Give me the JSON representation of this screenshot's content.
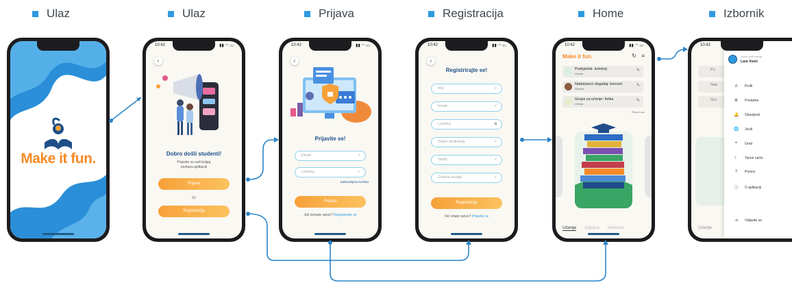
{
  "labels": [
    "Ulaz",
    "Ulaz",
    "Prijava",
    "Registracija",
    "Home",
    "Izbornik"
  ],
  "status": {
    "time": "10:42",
    "icons": "▮▮ ◠ ▭"
  },
  "splash": {
    "logo_text": "Make it fun."
  },
  "welcome": {
    "title": "Dobro došli studenti!",
    "subtitle": "Prijavite se radi boljeg pristupa aplikaciji",
    "login_button": "Prijava",
    "or_text": "ILI",
    "register_button": "Registracija"
  },
  "login": {
    "title": "Prijavite se!",
    "email_placeholder": "Email",
    "password_placeholder": "Lozinka",
    "forgot": "Zaboravljena lozinka",
    "login_button": "Prijava",
    "no_account": "Još nemate račun?",
    "register_link": "Registrirajte se"
  },
  "register": {
    "title": "Registrirajte se!",
    "fields": [
      "Ime",
      "Email",
      "Lozinka",
      "Smjer studiranja",
      "Studij",
      "Godina studija"
    ],
    "register_button": "Registracija",
    "have_account": "Već imate račun?",
    "login_link": "Prijavite se"
  },
  "home": {
    "brand": "Make it fun.",
    "items": [
      {
        "title": "Podsjetnik- kolokvij",
        "tag": "Učenje"
      },
      {
        "title": "Nadolazeći događaj: koncert",
        "tag": "Zabava"
      },
      {
        "title": "Grupa za učenje- fizika",
        "tag": "Učenje"
      }
    ],
    "see_all": "Prikaži sve",
    "tabs": [
      "Učenje",
      "Zabava",
      "Network"
    ]
  },
  "menu": {
    "greeting": "Dobro došli natrag",
    "user_name": "Lara Vusić",
    "items": [
      {
        "icon": "♙",
        "label": "Profil"
      },
      {
        "icon": "⚙",
        "label": "Postavke"
      },
      {
        "icon": "🔔",
        "label": "Obavijesti"
      },
      {
        "icon": "🌐",
        "label": "Jezik"
      },
      {
        "icon": "⌖",
        "label": "Grad"
      },
      {
        "icon": "☾",
        "label": "Tamni način"
      },
      {
        "icon": "?",
        "label": "Pomoć"
      },
      {
        "icon": "ⓘ",
        "label": "O aplikaciji"
      }
    ],
    "logout": "Odjavite se",
    "behind_items": [
      "Po",
      "Nad",
      "Gru"
    ],
    "behind_tab": "Učenje"
  },
  "colors": {
    "accent": "#2f9ae0",
    "navy": "#1d4f88",
    "orange": "#f7a13a"
  }
}
